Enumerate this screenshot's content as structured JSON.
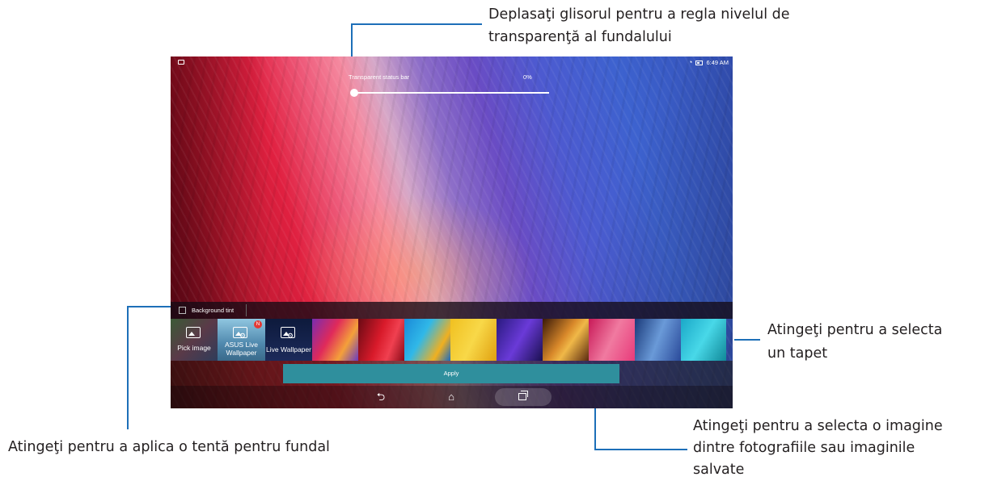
{
  "annotations": {
    "slider_line1": "Deplasaţi glisorul pentru a regla nivelul de",
    "slider_line2": "transparenţă al fundalului",
    "wallpaper_line1": "Atingeţi pentru a selecta",
    "wallpaper_line2": "un tapet",
    "image_line1": "Atingeţi pentru a selecta o imagine",
    "image_line2": "dintre fotografiile sau imaginile",
    "image_line3": "salvate",
    "tint": "Atingeţi pentru a aplica o tentă pentru fundal",
    "accent_color": "#1d6fb8"
  },
  "status_bar": {
    "time": "6:49 AM",
    "left_icon": "image-notification-icon",
    "wifi_icon": "wifi-icon",
    "battery_icon": "battery-icon"
  },
  "transparency": {
    "label": "Transparent status bar",
    "value_text": "0%",
    "value_fraction": 0.0
  },
  "background_tint": {
    "label": "Background tint",
    "checked": false
  },
  "wallpaper_picker": {
    "items": [
      {
        "label": "Pick image",
        "icon": "image-icon"
      },
      {
        "label": "ASUS Live Wallpaper",
        "icon": "wallpaper-settings-icon",
        "badge": "N"
      },
      {
        "label": "Live Wallpaper",
        "icon": "wallpaper-settings-icon"
      }
    ],
    "wallpaper_count": 9
  },
  "apply_label": "Apply",
  "navigation": {
    "back_icon": "back-icon",
    "home_icon": "home-icon",
    "recents_icon": "recents-icon"
  },
  "colors": {
    "apply_button": "#2f8f9d"
  }
}
